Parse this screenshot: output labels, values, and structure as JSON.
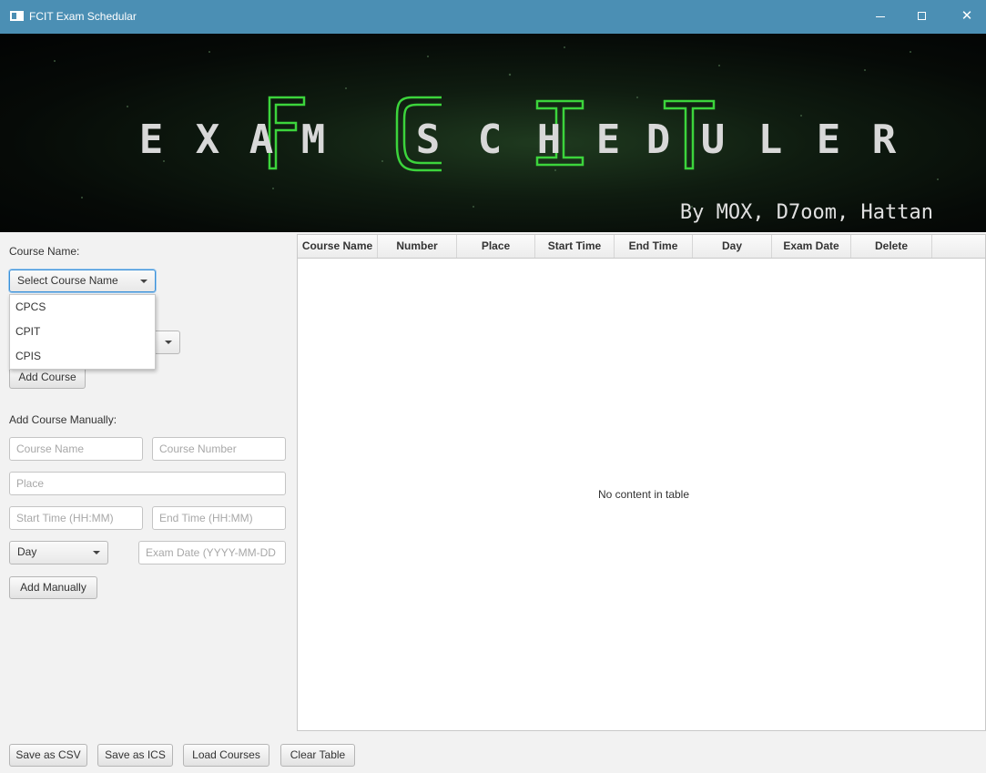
{
  "window": {
    "title": "FCIT Exam Schedular"
  },
  "banner": {
    "letters": [
      "E",
      "X",
      "A",
      "M",
      "S",
      "C",
      "H",
      "E",
      "D",
      "U",
      "L",
      "E",
      "R"
    ],
    "credits": "By MOX, D7oom, Hattan",
    "accent_color": "#3cd43c"
  },
  "left": {
    "course_name_label": "Course Name:",
    "course_combo_value": "Select Course Name",
    "course_options": [
      "CPCS",
      "CPIT",
      "CPIS"
    ],
    "add_course_button": "Add Course",
    "manual_label": "Add Course Manually:",
    "placeholders": {
      "course_name": "Course Name",
      "course_number": "Course Number",
      "place": "Place",
      "start_time": "Start Time (HH:MM)",
      "end_time": "End Time (HH:MM)",
      "exam_date": "Exam Date (YYYY-MM-DD"
    },
    "day_combo_value": "Day",
    "add_manually_button": "Add Manually"
  },
  "table": {
    "columns": [
      "Course Name",
      "Number",
      "Place",
      "Start Time",
      "End Time",
      "Day",
      "Exam Date",
      "Delete"
    ],
    "empty_text": "No content in table"
  },
  "bottom": {
    "save_csv": "Save as CSV",
    "save_ics": "Save as ICS",
    "load_courses": "Load Courses",
    "clear_table": "Clear Table"
  }
}
